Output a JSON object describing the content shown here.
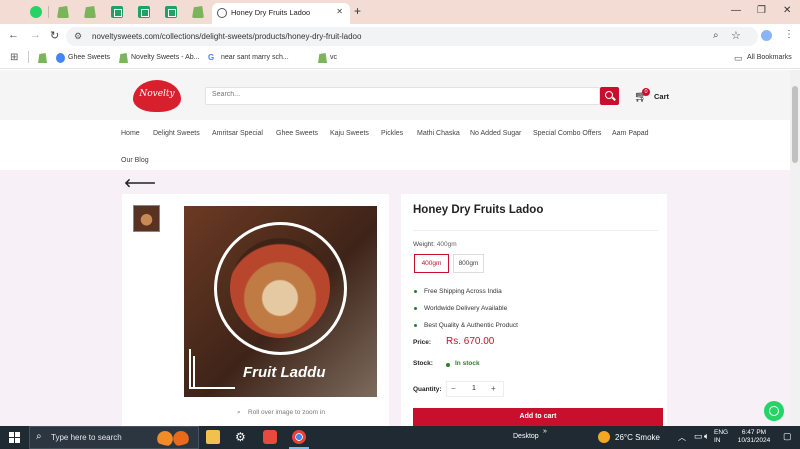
{
  "browser": {
    "active_tab_title": "Honey Dry Fruits Ladoo",
    "url": "noveltysweets.com/collections/delight-sweets/products/honey-dry-fruit-ladoo",
    "bookmarks": [
      "Ghee Sweets",
      "Novelty Sweets - Ab...",
      "near sant marry sch...",
      "vc"
    ],
    "all_bookmarks": "All Bookmarks"
  },
  "site": {
    "logo_text": "Novelty",
    "search_placeholder": "Search...",
    "cart_label": "Cart",
    "cart_count": "0",
    "nav": [
      "Home",
      "Delight Sweets",
      "Amritsar Special",
      "Ghee Sweets",
      "Kaju Sweets",
      "Pickles",
      "Mathi Chaska",
      "No Added Sugar",
      "Special Combo Offers",
      "Aam Papad",
      "Our Blog"
    ]
  },
  "product": {
    "image_caption": "Fruit Laddu",
    "zoom_hint": "Roll over image to zoom in",
    "title": "Honey Dry Fruits Ladoo",
    "weight_label": "Weight:",
    "weight_selected": "400gm",
    "weights": [
      "400gm",
      "800gm"
    ],
    "features": [
      "Free Shipping Across India",
      "Worldwide Delivery Available",
      "Best Quality & Authentic Product"
    ],
    "price_label": "Price:",
    "price": "Rs. 670.00",
    "stock_label": "Stock:",
    "stock_status": "In stock",
    "quantity_label": "Quantity:",
    "quantity": "1",
    "minus": "−",
    "plus": "+",
    "add_to_cart": "Add to cart"
  },
  "taskbar": {
    "search_placeholder": "Type here to search",
    "desktop_label": "Desktop",
    "weather": "26°C  Smoke",
    "lang_top": "ENG",
    "lang_bottom": "IN",
    "time": "6:47 PM",
    "date": "10/31/2024"
  },
  "colors": {
    "accent": "#c8102e",
    "stock": "#2e7d32",
    "tabstrip": "#f3dcd3"
  }
}
